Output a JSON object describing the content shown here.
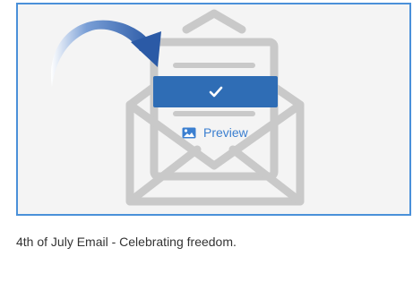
{
  "card": {
    "preview_label": "Preview",
    "caption": "4th of July Email - Celebrating freedom.",
    "icons": {
      "select": "checkmark-icon",
      "preview": "image-icon",
      "envelope": "envelope-icon",
      "arrow": "curved-arrow-icon"
    },
    "colors": {
      "border": "#4a90d9",
      "button": "#2f6db5",
      "arrow": "#2b5aa6",
      "envelope": "#c9c9c9",
      "link": "#3b7fd0"
    }
  }
}
